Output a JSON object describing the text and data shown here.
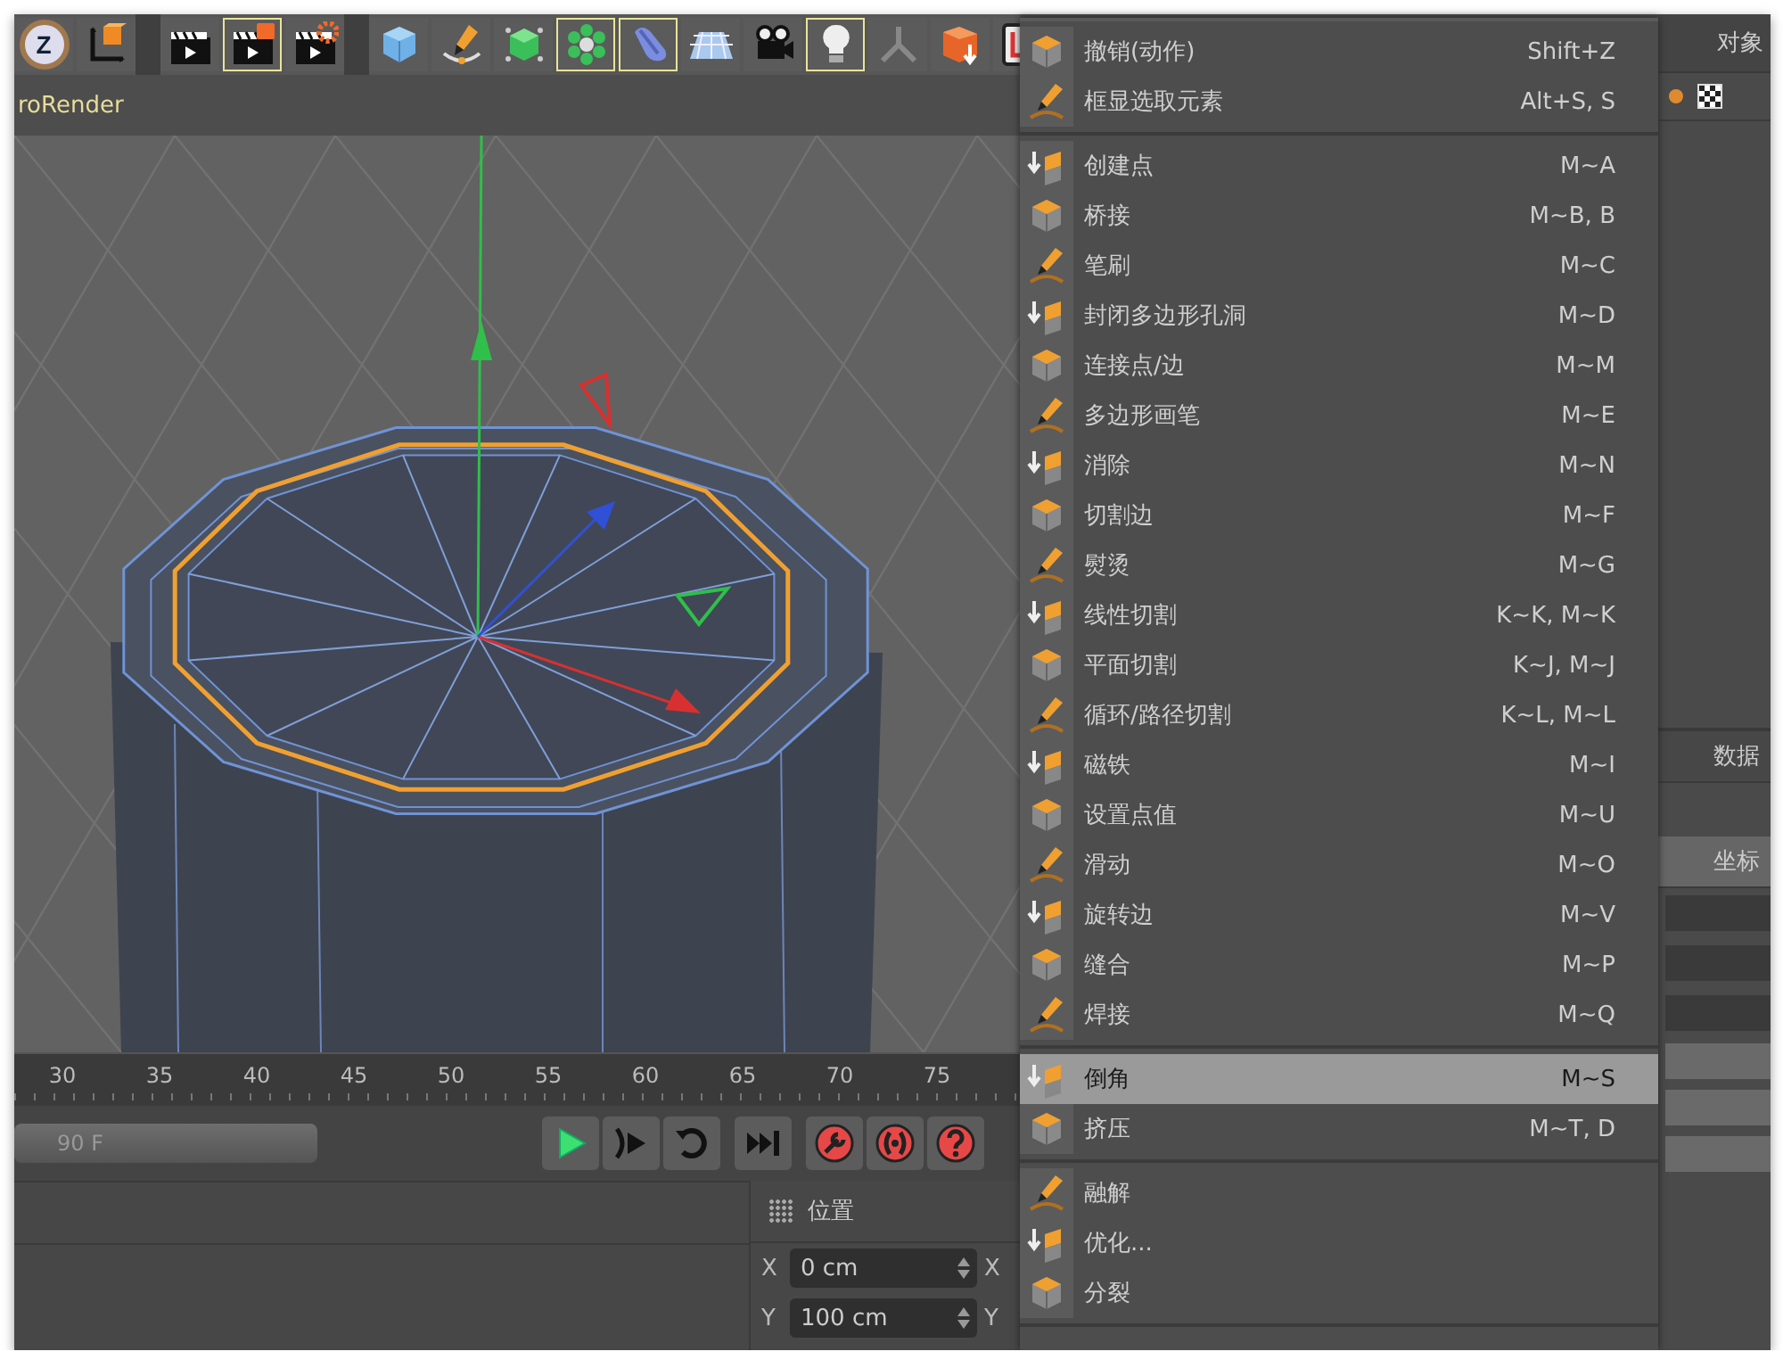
{
  "toolbar": {
    "groups": [
      [
        {
          "kind": "z-logo",
          "label": "Z",
          "selected": false
        },
        {
          "kind": "axes",
          "selected": false
        }
      ],
      [
        {
          "kind": "clapper",
          "selected": false
        },
        {
          "kind": "clapper-orange",
          "selected": true
        },
        {
          "kind": "clapper-gear",
          "selected": false
        }
      ],
      [
        {
          "kind": "cube",
          "selected": false
        },
        {
          "kind": "pen",
          "selected": false
        },
        {
          "kind": "green-cube",
          "selected": false
        },
        {
          "kind": "cluster",
          "selected": true
        },
        {
          "kind": "bent",
          "selected": true
        },
        {
          "kind": "floor",
          "selected": false
        },
        {
          "kind": "camera",
          "selected": false
        },
        {
          "kind": "bulb",
          "selected": true
        },
        {
          "kind": "joint",
          "selected": false
        },
        {
          "kind": "box",
          "selected": false
        },
        {
          "kind": "frame",
          "selected": false
        }
      ]
    ]
  },
  "viewport": {
    "title": "roRender"
  },
  "timeline": {
    "ticks": [
      "30",
      "35",
      "40",
      "45",
      "50",
      "55",
      "60",
      "65",
      "70",
      "75"
    ],
    "frame_field": "90 F",
    "buttons": [
      {
        "kind": "play"
      },
      {
        "kind": "step"
      },
      {
        "kind": "loop"
      },
      {
        "kind": "skip-end"
      },
      {
        "kind": "key"
      },
      {
        "kind": "parens"
      },
      {
        "kind": "help"
      }
    ]
  },
  "coordinates": {
    "title": "位置",
    "rows": [
      {
        "axis": "X",
        "value": "0 cm",
        "axis_2": "X"
      },
      {
        "axis": "Y",
        "value": "100 cm",
        "axis_2": "Y"
      }
    ]
  },
  "context_menu": {
    "sections": [
      {
        "items": [
          {
            "label": "撤销(动作)",
            "shortcut": "Shift+Z",
            "selected": false
          },
          {
            "label": "框显选取元素",
            "shortcut": "Alt+S, S",
            "selected": false
          }
        ]
      },
      {
        "items": [
          {
            "label": "创建点",
            "shortcut": "M~A",
            "selected": false
          },
          {
            "label": "桥接",
            "shortcut": "M~B, B",
            "selected": false
          },
          {
            "label": "笔刷",
            "shortcut": "M~C",
            "selected": false
          },
          {
            "label": "封闭多边形孔洞",
            "shortcut": "M~D",
            "selected": false
          },
          {
            "label": "连接点/边",
            "shortcut": "M~M",
            "selected": false
          },
          {
            "label": "多边形画笔",
            "shortcut": "M~E",
            "selected": false
          },
          {
            "label": "消除",
            "shortcut": "M~N",
            "selected": false
          },
          {
            "label": "切割边",
            "shortcut": "M~F",
            "selected": false
          },
          {
            "label": "熨烫",
            "shortcut": "M~G",
            "selected": false
          },
          {
            "label": "线性切割",
            "shortcut": "K~K, M~K",
            "selected": false
          },
          {
            "label": "平面切割",
            "shortcut": "K~J, M~J",
            "selected": false
          },
          {
            "label": "循环/路径切割",
            "shortcut": "K~L, M~L",
            "selected": false
          },
          {
            "label": "磁铁",
            "shortcut": "M~I",
            "selected": false
          },
          {
            "label": "设置点值",
            "shortcut": "M~U",
            "selected": false
          },
          {
            "label": "滑动",
            "shortcut": "M~O",
            "selected": false
          },
          {
            "label": "旋转边",
            "shortcut": "M~V",
            "selected": false
          },
          {
            "label": "缝合",
            "shortcut": "M~P",
            "selected": false
          },
          {
            "label": "焊接",
            "shortcut": "M~Q",
            "selected": false
          }
        ]
      },
      {
        "items": [
          {
            "label": "倒角",
            "shortcut": "M~S",
            "selected": true
          },
          {
            "label": "挤压",
            "shortcut": "M~T, D",
            "selected": false
          }
        ]
      },
      {
        "items": [
          {
            "label": "融解",
            "selected": false
          },
          {
            "label": "优化...",
            "selected": false
          },
          {
            "label": "分裂",
            "selected": false
          }
        ]
      }
    ]
  },
  "side_panel": {
    "header": "对象",
    "tabs": [
      {
        "label": "数据",
        "selected": false
      },
      {
        "label": "坐标",
        "selected": true
      }
    ]
  }
}
